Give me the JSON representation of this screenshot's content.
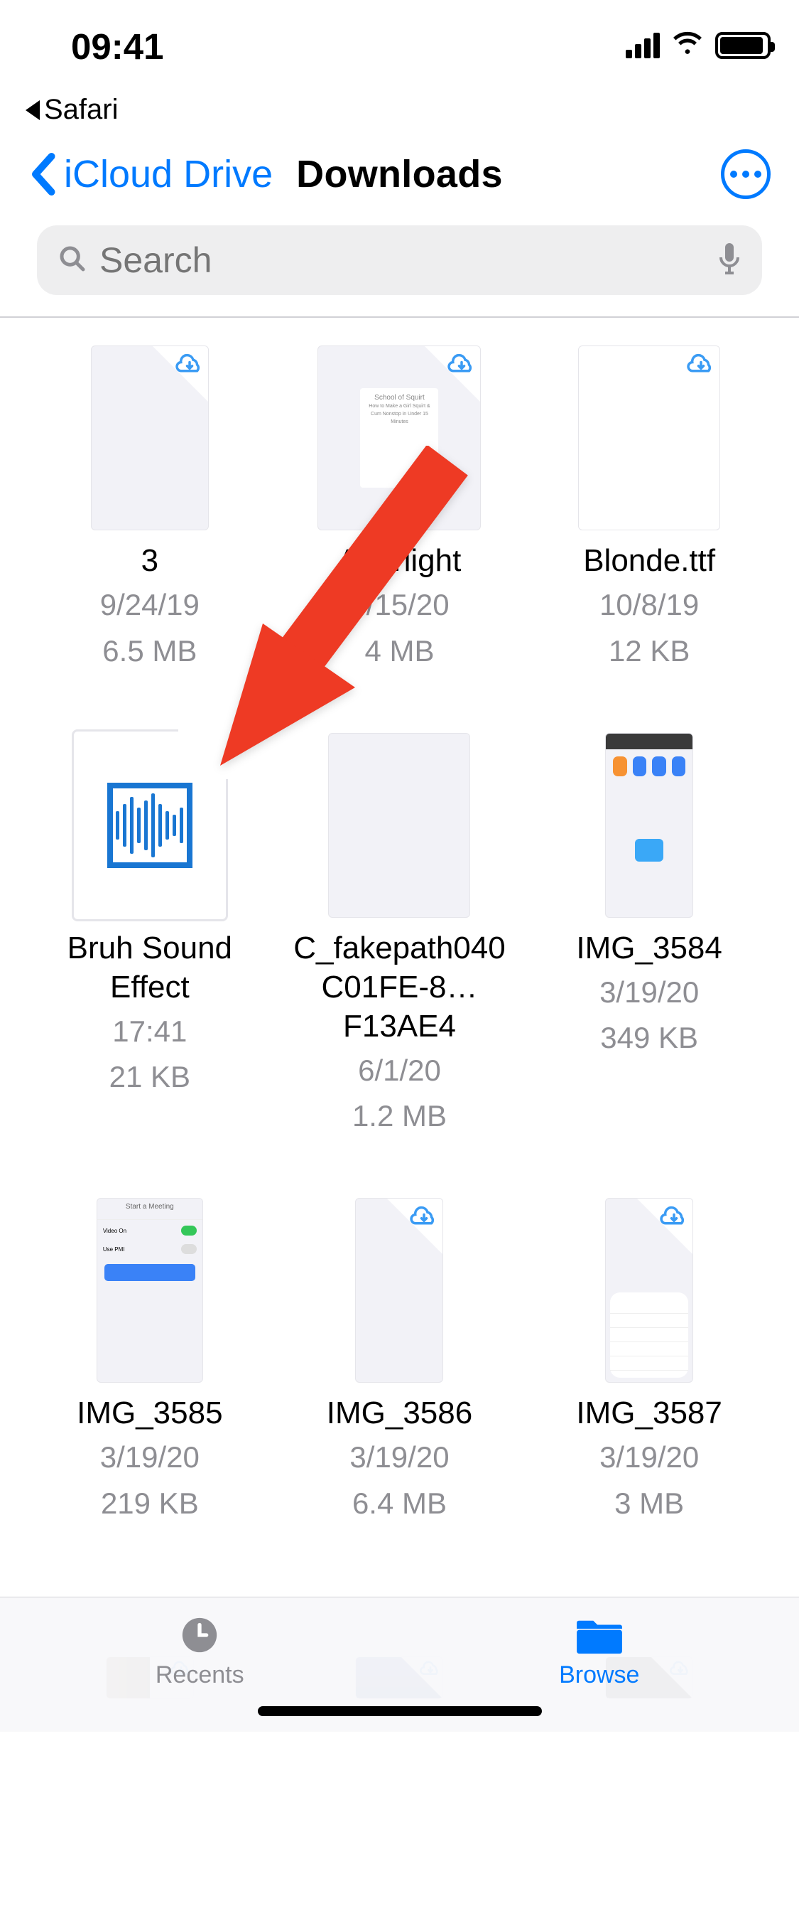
{
  "status": {
    "time": "09:41",
    "back_app": "Safari"
  },
  "nav": {
    "back_label": "iCloud Drive",
    "title": "Downloads"
  },
  "search": {
    "placeholder": "Search"
  },
  "files": [
    {
      "name": "3",
      "date": "9/24/19",
      "size": "6.5 MB",
      "cloud": true
    },
    {
      "name": "Afterlight",
      "date": "3/15/20",
      "size": "4 MB",
      "cloud": true
    },
    {
      "name": "Blonde.ttf",
      "date": "10/8/19",
      "size": "12 KB",
      "cloud": true
    },
    {
      "name": "Bruh Sound Effect",
      "date": "17:41",
      "size": "21 KB",
      "cloud": false
    },
    {
      "name": "C_fakepath040C01FE-8…F13AE4",
      "date": "6/1/20",
      "size": "1.2 MB",
      "cloud": false
    },
    {
      "name": "IMG_3584",
      "date": "3/19/20",
      "size": "349 KB",
      "cloud": false
    },
    {
      "name": "IMG_3585",
      "date": "3/19/20",
      "size": "219 KB",
      "cloud": false
    },
    {
      "name": "IMG_3586",
      "date": "3/19/20",
      "size": "6.4 MB",
      "cloud": true
    },
    {
      "name": "IMG_3587",
      "date": "3/19/20",
      "size": "3 MB",
      "cloud": true
    }
  ],
  "tabs": {
    "recents": "Recents",
    "browse": "Browse"
  }
}
